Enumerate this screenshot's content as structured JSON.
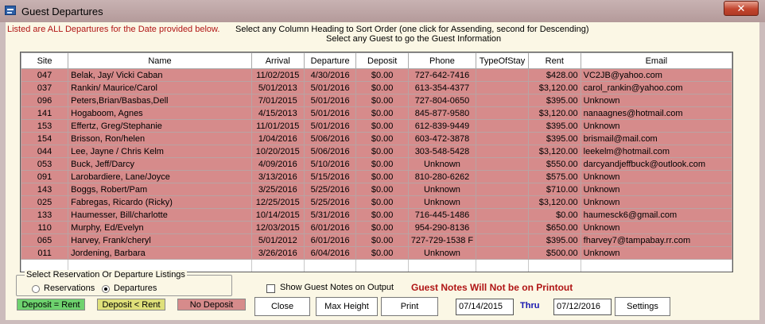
{
  "window": {
    "title": "Guest Departures",
    "close_label": "✕"
  },
  "info": {
    "line1": "Listed are ALL Departures for the Date provided below.",
    "line2": "Select any Column Heading to Sort Order (one click for Assending, second for Descending)",
    "line3": "Select any Guest to go the Guest Information"
  },
  "table": {
    "columns": [
      "Site",
      "Name",
      "Arrival",
      "Departure",
      "Deposit",
      "Phone",
      "TypeOfStay",
      "Rent",
      "Email"
    ],
    "rows": [
      {
        "site": "047",
        "name": "Belak, Jay/ Vicki Caban",
        "arrival": "11/02/2015",
        "departure": "4/30/2016",
        "deposit": "$0.00",
        "phone": "727-642-7416",
        "type": "",
        "rent": "$428.00",
        "email": "VC2JB@yahoo.com"
      },
      {
        "site": "037",
        "name": "Rankin/ Maurice/Carol",
        "arrival": "5/01/2013",
        "departure": "5/01/2016",
        "deposit": "$0.00",
        "phone": "613-354-4377",
        "type": "",
        "rent": "$3,120.00",
        "email": "carol_rankin@yahoo.com"
      },
      {
        "site": "096",
        "name": "Peters,Brian/Basbas,Dell",
        "arrival": "7/01/2015",
        "departure": "5/01/2016",
        "deposit": "$0.00",
        "phone": "727-804-0650",
        "type": "",
        "rent": "$395.00",
        "email": "Unknown"
      },
      {
        "site": "141",
        "name": "Hogaboom, Agnes",
        "arrival": "4/15/2013",
        "departure": "5/01/2016",
        "deposit": "$0.00",
        "phone": "845-877-9580",
        "type": "",
        "rent": "$3,120.00",
        "email": "nanaagnes@hotmail.com"
      },
      {
        "site": "153",
        "name": "Effertz, Greg/Stephanie",
        "arrival": "11/01/2015",
        "departure": "5/01/2016",
        "deposit": "$0.00",
        "phone": "612-839-9449",
        "type": "",
        "rent": "$395.00",
        "email": "Unknown"
      },
      {
        "site": "154",
        "name": "Brisson, Ron/helen",
        "arrival": "1/04/2016",
        "departure": "5/06/2016",
        "deposit": "$0.00",
        "phone": "603-472-3878",
        "type": "",
        "rent": "$395.00",
        "email": "brismail@mail.com"
      },
      {
        "site": "044",
        "name": "Lee, Jayne / Chris Kelm",
        "arrival": "10/20/2015",
        "departure": "5/06/2016",
        "deposit": "$0.00",
        "phone": "303-548-5428",
        "type": "",
        "rent": "$3,120.00",
        "email": "leekelm@hotmail.com"
      },
      {
        "site": "053",
        "name": "Buck, Jeff/Darcy",
        "arrival": "4/09/2016",
        "departure": "5/10/2016",
        "deposit": "$0.00",
        "phone": "Unknown",
        "type": "",
        "rent": "$550.00",
        "email": "darcyandjeffbuck@outlook.com"
      },
      {
        "site": "091",
        "name": "Larobardiere, Lane/Joyce",
        "arrival": "3/13/2016",
        "departure": "5/15/2016",
        "deposit": "$0.00",
        "phone": "810-280-6262",
        "type": "",
        "rent": "$575.00",
        "email": "Unknown"
      },
      {
        "site": "143",
        "name": "Boggs, Robert/Pam",
        "arrival": "3/25/2016",
        "departure": "5/25/2016",
        "deposit": "$0.00",
        "phone": "Unknown",
        "type": "",
        "rent": "$710.00",
        "email": "Unknown"
      },
      {
        "site": "025",
        "name": "Fabregas, Ricardo (Ricky)",
        "arrival": "12/25/2015",
        "departure": "5/25/2016",
        "deposit": "$0.00",
        "phone": "Unknown",
        "type": "",
        "rent": "$3,120.00",
        "email": "Unknown"
      },
      {
        "site": "133",
        "name": "Haumesser, Bill/charlotte",
        "arrival": "10/14/2015",
        "departure": "5/31/2016",
        "deposit": "$0.00",
        "phone": "716-445-1486",
        "type": "",
        "rent": "$0.00",
        "email": "haumesck6@gmail.com"
      },
      {
        "site": "110",
        "name": "Murphy, Ed/Evelyn",
        "arrival": "12/03/2015",
        "departure": "6/01/2016",
        "deposit": "$0.00",
        "phone": "954-290-8136",
        "type": "",
        "rent": "$650.00",
        "email": "Unknown"
      },
      {
        "site": "065",
        "name": "Harvey, Frank/cheryl",
        "arrival": "5/01/2012",
        "departure": "6/01/2016",
        "deposit": "$0.00",
        "phone": "727-729-1538 F",
        "type": "",
        "rent": "$395.00",
        "email": "fharvey7@tampabay.rr.com"
      },
      {
        "site": "011",
        "name": "Jordening, Barbara",
        "arrival": "3/26/2016",
        "departure": "6/04/2016",
        "deposit": "$0.00",
        "phone": "Unknown",
        "type": "",
        "rent": "$500.00",
        "email": "Unknown"
      }
    ]
  },
  "listing": {
    "group_label": "Select Reservation Or Departure Listings",
    "options": [
      "Reservations",
      "Departures"
    ],
    "selected": "Departures"
  },
  "show_notes": {
    "label": "Show Guest Notes on Output",
    "checked": false
  },
  "notes_warning": "Guest Notes Will Not be on Printout",
  "legend": [
    {
      "label": "Deposit = Rent",
      "color": "#6ed26e"
    },
    {
      "label": "Deposit < Rent",
      "color": "#dfe07a"
    },
    {
      "label": "No Deposit",
      "color": "#d68b8b"
    }
  ],
  "buttons": {
    "close": "Close",
    "max_height": "Max Height",
    "print": "Print",
    "settings": "Settings"
  },
  "date_range": {
    "from": "07/14/2015",
    "thru_label": "Thru",
    "to": "07/12/2016"
  }
}
